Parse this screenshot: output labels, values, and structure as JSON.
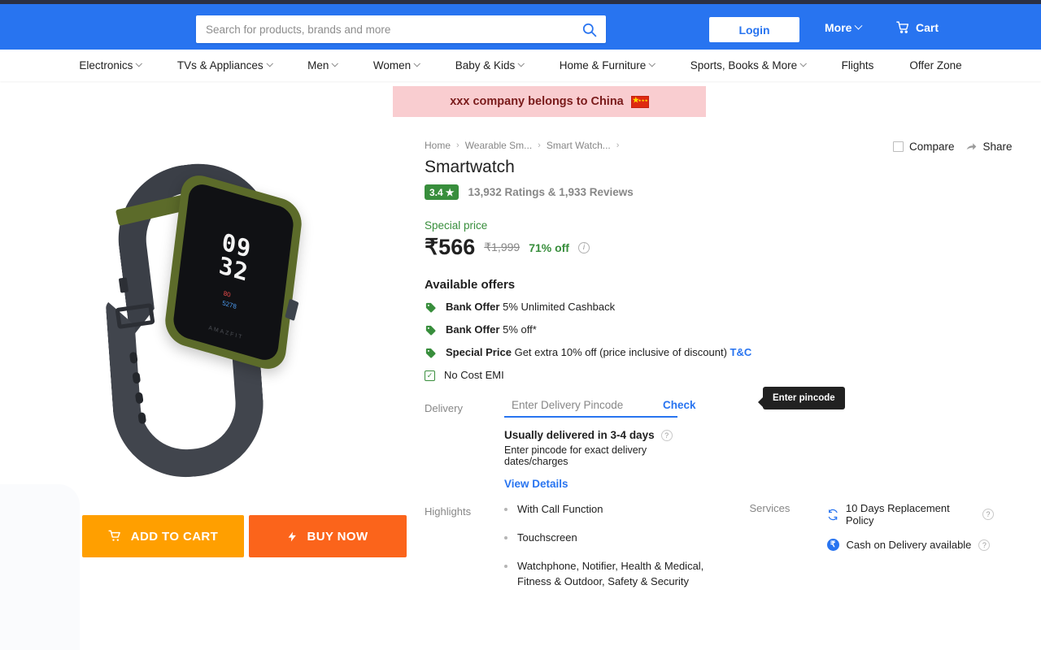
{
  "header": {
    "search": {
      "placeholder": "Search for products, brands and more",
      "value": "",
      "icon": "search-icon"
    },
    "login_label": "Login",
    "more_label": "More",
    "cart_label": "Cart"
  },
  "nav": {
    "items": [
      {
        "label": "Electronics",
        "has_chevron": true
      },
      {
        "label": "TVs & Appliances",
        "has_chevron": true
      },
      {
        "label": "Men",
        "has_chevron": true
      },
      {
        "label": "Women",
        "has_chevron": true
      },
      {
        "label": "Baby & Kids",
        "has_chevron": true
      },
      {
        "label": "Home & Furniture",
        "has_chevron": true
      },
      {
        "label": "Sports, Books & More",
        "has_chevron": true
      },
      {
        "label": "Flights",
        "has_chevron": false
      },
      {
        "label": "Offer Zone",
        "has_chevron": false
      }
    ]
  },
  "banner": {
    "text": "xxx company belongs to China",
    "flag": "china-flag-icon",
    "bg": "#f9cdd0",
    "color": "#7a1b1b"
  },
  "compare_share": {
    "compare_label": "Compare",
    "share_label": "Share",
    "compare_checked": false
  },
  "product": {
    "breadcrumb": [
      "Home",
      "Wearable Sm...",
      "Smart Watch..."
    ],
    "title": "Smartwatch",
    "rating_value": "3.4",
    "rating_star": "★",
    "reviews_text": "13,932 Ratings & 1,933 Reviews",
    "special_price_label": "Special price",
    "price": "₹566",
    "price_old": "₹1,999",
    "discount": "71% off",
    "image_alt": "smartwatch-product-image",
    "watch_display": {
      "time_line1": "09",
      "time_line2": "32",
      "heart_rate": "80",
      "steps": "5278",
      "brand": "AMAZFIT"
    }
  },
  "offers": {
    "title": "Available offers",
    "items": [
      {
        "icon": "offer-tag-icon",
        "bold": "Bank Offer",
        "text": "5% Unlimited Cashback",
        "link": ""
      },
      {
        "icon": "offer-tag-icon",
        "bold": "Bank Offer",
        "text": "5% off*",
        "link": ""
      },
      {
        "icon": "offer-tag-icon",
        "bold": "Special Price",
        "text": "Get extra 10% off (price inclusive of discount)",
        "link": "T&C"
      },
      {
        "icon": "emi-check-icon",
        "bold": "",
        "text": "No Cost EMI",
        "link": ""
      }
    ]
  },
  "delivery": {
    "label": "Delivery",
    "pincode_placeholder": "Enter Delivery Pincode",
    "pincode_value": "",
    "check_label": "Check",
    "tooltip": "Enter pincode",
    "eta": "Usually delivered in 3-4 days",
    "note": "Enter pincode for exact delivery dates/charges",
    "view_details": "View Details"
  },
  "highlights": {
    "label": "Highlights",
    "items": [
      "With Call Function",
      "Touchscreen",
      "Watchphone, Notifier, Health & Medical, Fitness & Outdoor, Safety & Security"
    ]
  },
  "services": {
    "label": "Services",
    "items": [
      {
        "icon": "replacement-icon",
        "text": "10 Days Replacement Policy"
      },
      {
        "icon": "cod-icon",
        "text": "Cash on Delivery available"
      }
    ]
  },
  "actions": {
    "add_to_cart": "ADD TO CART",
    "buy_now": "BUY NOW",
    "cart_color": "#ff9f00",
    "buy_color": "#fb641b"
  },
  "theme": {
    "brand_blue": "#2874f0",
    "green": "#388e3c",
    "dark_strip": "#2b3044"
  }
}
